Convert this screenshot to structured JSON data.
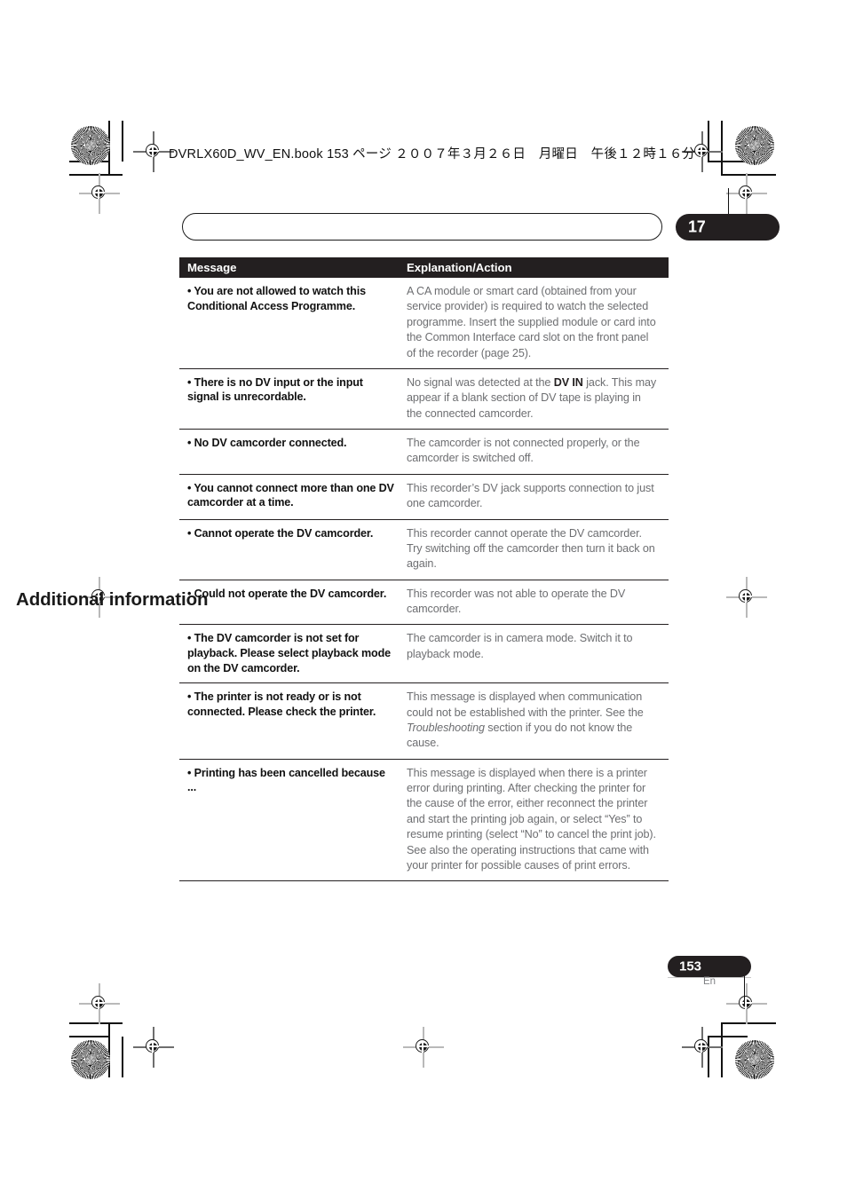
{
  "book_header": "DVRLX60D_WV_EN.book  153 ページ  ２００７年３月２６日　月曜日　午後１２時１６分",
  "chapter": {
    "title": "Additional information",
    "number": "17"
  },
  "table": {
    "headers": {
      "message": "Message",
      "explanation": "Explanation/Action"
    },
    "rows": [
      {
        "message": "• You are not allowed to watch this Conditional Access Programme.",
        "explanation_html": "A CA module or smart card (obtained from your service provider) is required to watch the selected programme. Insert the supplied module or card into the Common Interface card slot on the front panel of the recorder (page 25)."
      },
      {
        "message": "• There is no DV input or the input signal is unrecordable.",
        "explanation_html": "No signal was detected at the <b>DV IN</b> jack. This may appear if a blank section of DV tape is playing in the connected camcorder."
      },
      {
        "message": "• No DV camcorder connected.",
        "explanation_html": "The camcorder is not connected properly, or the camcorder is switched off."
      },
      {
        "message": "• You cannot connect more than one DV camcorder at a time.",
        "explanation_html": "This recorder’s DV jack supports connection to just one camcorder."
      },
      {
        "message": "• Cannot operate the DV camcorder.",
        "explanation_html": "This recorder cannot operate the DV camcorder. Try switching off the camcorder then turn it back on again."
      },
      {
        "message": "• Could not operate the DV camcorder.",
        "explanation_html": "This recorder was not able to operate the DV camcorder."
      },
      {
        "message": "• The DV camcorder is not set for playback. Please select playback mode on the DV camcorder.",
        "explanation_html": "The camcorder is in camera mode. Switch it to playback mode."
      },
      {
        "message": "• The printer is not ready or is not connected. Please check the printer.",
        "explanation_html": "This message is displayed when communication could not be established with the printer. See the <i>Troubleshooting</i> section if you do not know the cause."
      },
      {
        "message": "• Printing has been cancelled because ...",
        "explanation_html": "This message is displayed when there is a printer error during printing. After checking the printer for the cause of the error, either reconnect the printer and start the printing job again, or select “Yes” to resume printing (select “No” to cancel the print job). See also the operating instructions that came with your printer for possible causes of print errors."
      }
    ]
  },
  "footer": {
    "page_number": "153",
    "language": "En"
  },
  "colors": {
    "ink_black": "#231f20",
    "body_gray": "#6d6e71"
  }
}
